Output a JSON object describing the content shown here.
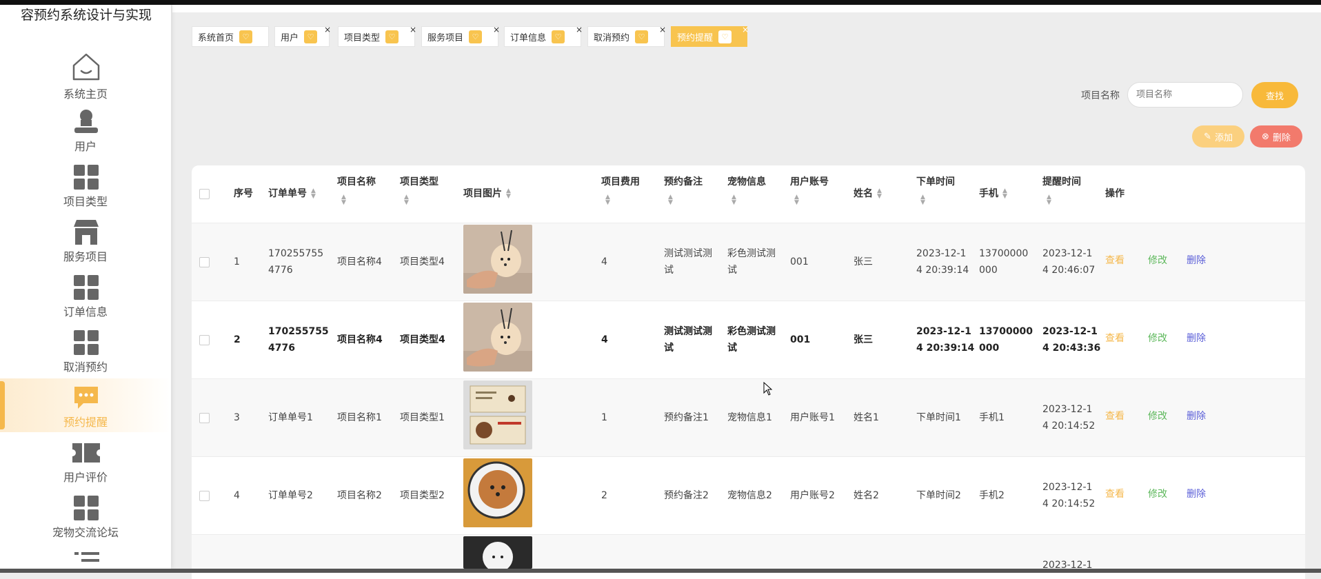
{
  "app": {
    "title": "容预约系统设计与实现"
  },
  "sidebar": {
    "items": [
      {
        "label": "系统主页",
        "icon": "home-icon"
      },
      {
        "label": "用户",
        "icon": "user-icon"
      },
      {
        "label": "项目类型",
        "icon": "grid-icon"
      },
      {
        "label": "服务项目",
        "icon": "shop-icon"
      },
      {
        "label": "订单信息",
        "icon": "grid-icon"
      },
      {
        "label": "取消预约",
        "icon": "grid-icon"
      },
      {
        "label": "预约提醒",
        "icon": "chat-icon",
        "active": true
      },
      {
        "label": "用户评价",
        "icon": "ticket-icon"
      },
      {
        "label": "宠物交流论坛",
        "icon": "grid-icon"
      }
    ]
  },
  "tabs": [
    {
      "label": "系统首页"
    },
    {
      "label": "用户"
    },
    {
      "label": "项目类型"
    },
    {
      "label": "服务项目"
    },
    {
      "label": "订单信息"
    },
    {
      "label": "取消预约"
    },
    {
      "label": "预约提醒",
      "active": true
    }
  ],
  "search": {
    "label": "项目名称",
    "placeholder": "项目名称",
    "button": "查找"
  },
  "toolbar": {
    "add_label": "添加",
    "delete_label": "删除"
  },
  "table": {
    "headers": {
      "index": "序号",
      "order_no": "订单单号",
      "item_name": "项目名称",
      "item_type": "项目类型",
      "item_image": "项目图片",
      "item_fee": "项目费用",
      "note": "预约备注",
      "pet_info": "宠物信息",
      "account": "用户账号",
      "name": "姓名",
      "order_time": "下单时间",
      "phone": "手机",
      "remind_time": "提醒时间",
      "ops": "操作"
    },
    "actions": {
      "view": "查看",
      "edit": "修改",
      "delete": "删除"
    },
    "rows": [
      {
        "index": "1",
        "order_no_1": "170255755",
        "order_no_2": "4776",
        "item_name": "项目名称4",
        "item_type": "项目类型4",
        "fee": "4",
        "note_1": "测试测试测",
        "note_2": "试",
        "pet_1": "彩色测试测",
        "pet_2": "试",
        "account": "001",
        "name": "张三",
        "order_time_1": "2023-12-1",
        "order_time_2": "4 20:39:14",
        "phone_1": "13700000",
        "phone_2": "000",
        "remind_1": "2023-12-1",
        "remind_2": "4 20:46:07"
      },
      {
        "index": "2",
        "order_no_1": "170255755",
        "order_no_2": "4776",
        "item_name": "项目名称4",
        "item_type": "项目类型4",
        "fee": "4",
        "note_1": "测试测试测",
        "note_2": "试",
        "pet_1": "彩色测试测",
        "pet_2": "试",
        "account": "001",
        "name": "张三",
        "order_time_1": "2023-12-1",
        "order_time_2": "4 20:39:14",
        "phone_1": "13700000",
        "phone_2": "000",
        "remind_1": "2023-12-1",
        "remind_2": "4 20:43:36"
      },
      {
        "index": "3",
        "order_no_1": "订单单号1",
        "item_name": "项目名称1",
        "item_type": "项目类型1",
        "fee": "1",
        "note_1": "预约备注1",
        "pet_1": "宠物信息1",
        "account": "用户账号1",
        "name": "姓名1",
        "order_time_1": "下单时间1",
        "phone_1": "手机1",
        "remind_1": "2023-12-1",
        "remind_2": "4 20:14:52"
      },
      {
        "index": "4",
        "order_no_1": "订单单号2",
        "item_name": "项目名称2",
        "item_type": "项目类型2",
        "fee": "2",
        "note_1": "预约备注2",
        "pet_1": "宠物信息2",
        "account": "用户账号2",
        "name": "姓名2",
        "order_time_1": "下单时间2",
        "phone_1": "手机2",
        "remind_1": "2023-12-1",
        "remind_2": "4 20:14:52"
      },
      {
        "remind_1": "2023-12-1"
      }
    ]
  }
}
